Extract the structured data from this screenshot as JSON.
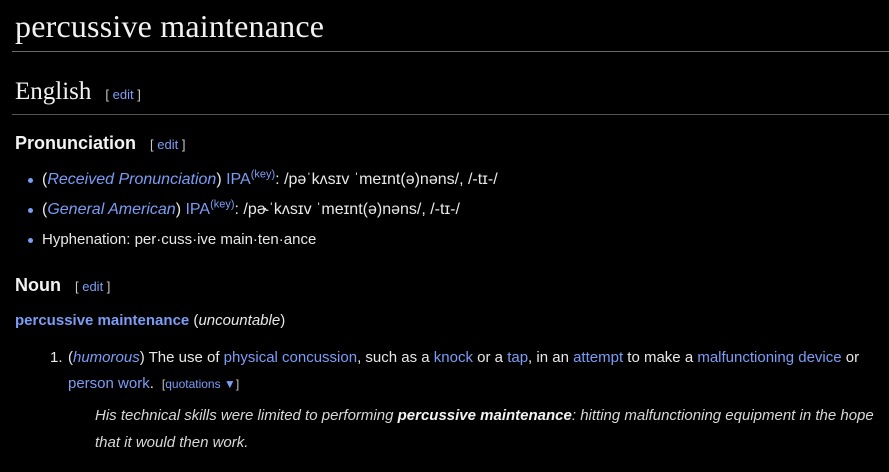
{
  "title": "percussive maintenance",
  "edit_label": "edit",
  "language": "English",
  "pronunciation": {
    "heading": "Pronunciation",
    "items": [
      {
        "accent": "Received Pronunciation",
        "ipa_label": "IPA",
        "key": "(key)",
        "ipa": ": /pəˈkʌsɪv ˈmeɪnt(ə)nəns/, /-tɪ-/"
      },
      {
        "accent": "General American",
        "ipa_label": "IPA",
        "key": "(key)",
        "ipa": ": /pɚˈkʌsɪv ˈmeɪnt(ə)nəns/, /-tɪ-/"
      }
    ],
    "hyphenation": "Hyphenation: per·cuss·ive main·ten·ance"
  },
  "noun": {
    "heading": "Noun",
    "headword": "percussive maintenance",
    "gram": "uncountable",
    "sense": {
      "number": "1.",
      "label": "humorous",
      "t1": "The use of",
      "l1": "physical concussion",
      "t2": ", such as a",
      "l2": "knock",
      "t3": "or a",
      "l3": "tap",
      "t4": ", in an",
      "l4": "attempt",
      "t5": "to make a",
      "l5": "malfunctioning device",
      "t6": "or",
      "l6": "person work",
      "t7": ".",
      "quotations": "quotations ▼"
    },
    "example": {
      "before": "His technical skills were limited to performing ",
      "bold": "percussive maintenance",
      "after": ": hitting malfunctioning equipment in the hope that it would then work."
    }
  },
  "colors": {
    "background": "#000000",
    "link": "#7b9df5",
    "text": "#e8e8e8"
  }
}
